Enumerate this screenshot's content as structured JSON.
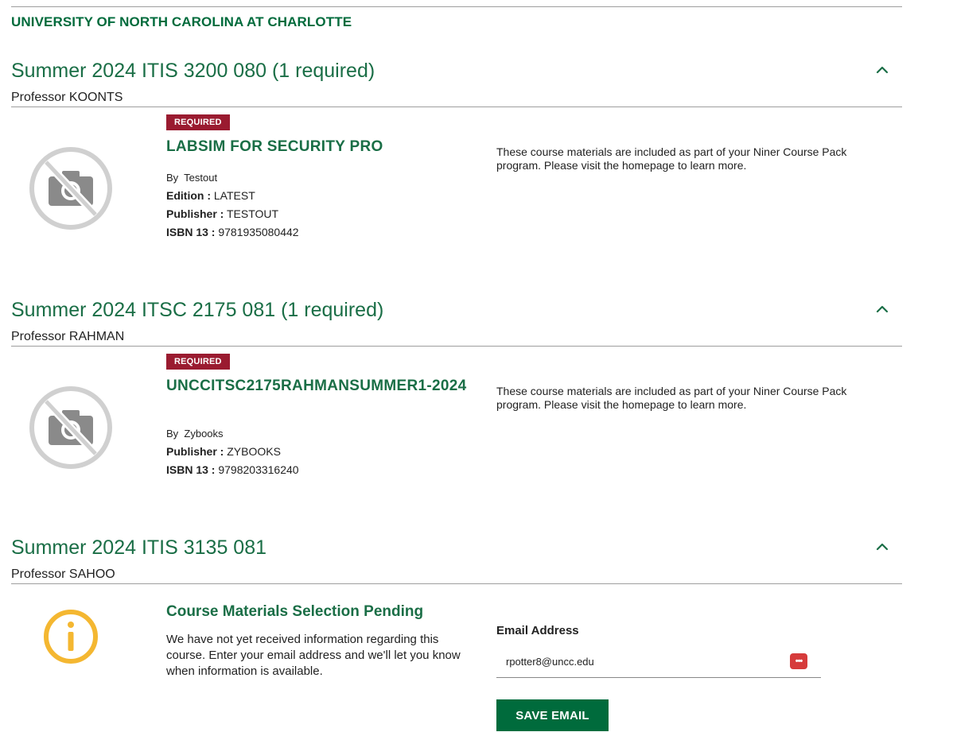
{
  "school": "UNIVERSITY OF NORTH CAROLINA AT CHARLOTTE",
  "courses": [
    {
      "title": "Summer 2024 ITIS 3200 080 (1 required)",
      "professor": "Professor KOONTS",
      "item": {
        "badge": "REQUIRED",
        "title": "LABSIM FOR SECURITY PRO",
        "by_prefix": "By",
        "author": "Testout",
        "edition_label": "Edition :",
        "edition": "LATEST",
        "publisher_label": "Publisher :",
        "publisher": "TESTOUT",
        "isbn_label": "ISBN 13 :",
        "isbn": "9781935080442",
        "note": "These course materials are included as part of your Niner Course Pack program. Please visit the homepage to learn more."
      }
    },
    {
      "title": "Summer 2024 ITSC 2175 081 (1 required)",
      "professor": "Professor RAHMAN",
      "item": {
        "badge": "REQUIRED",
        "title": "UNCCITSC2175RAHMANSUMMER1-2024",
        "by_prefix": "By",
        "author": "Zybooks",
        "publisher_label": "Publisher :",
        "publisher": "ZYBOOKS",
        "isbn_label": "ISBN 13 :",
        "isbn": "9798203316240",
        "note": "These course materials are included as part of your Niner Course Pack program. Please visit the homepage to learn more."
      }
    },
    {
      "title": "Summer 2024 ITIS 3135 081",
      "professor": "Professor SAHOO",
      "pending": {
        "title": "Course Materials Selection Pending",
        "text": "We have not yet received information regarding this course. Enter your email address and we'll let you know when information is available.",
        "email_label": "Email Address",
        "email_value": "rpotter8@uncc.edu",
        "button": "SAVE EMAIL"
      }
    }
  ],
  "colors": {
    "brand_green": "#006b3c",
    "badge_red": "#9a1b30",
    "info_yellow": "#f4b731"
  }
}
